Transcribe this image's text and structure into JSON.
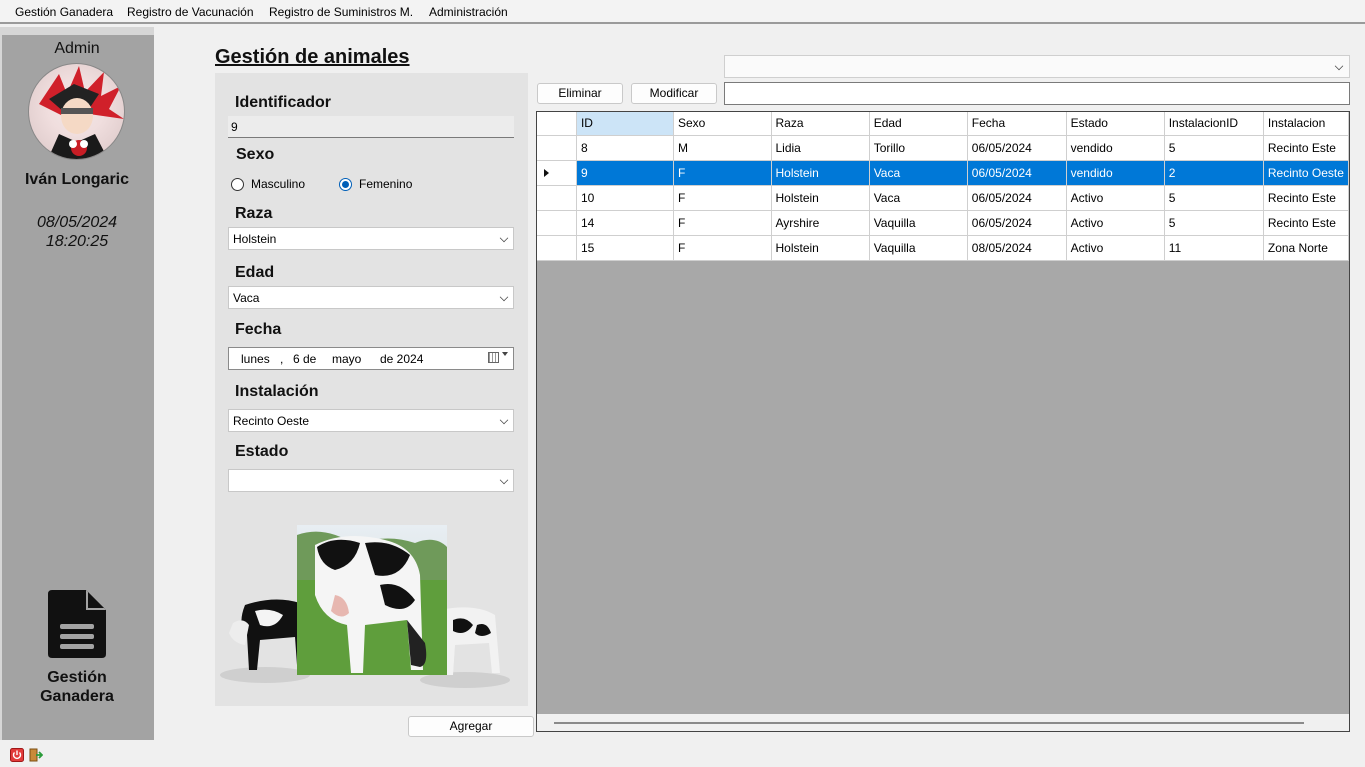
{
  "menu": [
    "Gestión Ganadera",
    "Registro de Vacunación",
    "Registro de Suministros M.",
    "Administración"
  ],
  "sidebar": {
    "role": "Admin",
    "user": "Iván Longaric",
    "date": "08/05/2024",
    "time": "18:20:25",
    "module_label_1": "Gestión",
    "module_label_2": "Ganadera"
  },
  "title": "Gestión de animales",
  "form": {
    "id_label": "Identificador",
    "id_value": "9",
    "sex_label": "Sexo",
    "sex_options": [
      "Masculino",
      "Femenino"
    ],
    "sex_selected": "Femenino",
    "breed_label": "Raza",
    "breed_value": "Holstein",
    "age_label": "Edad",
    "age_value": "Vaca",
    "date_label": "Fecha",
    "date_parts": {
      "weekday": "lunes",
      "sep": ",",
      "day": "6 de",
      "month": "mayo",
      "year": "de 2024"
    },
    "install_label": "Instalación",
    "install_value": "Recinto Oeste",
    "state_label": "Estado",
    "state_value": ""
  },
  "buttons": {
    "delete": "Eliminar",
    "modify": "Modificar",
    "add": "Agregar"
  },
  "table": {
    "columns": [
      "ID",
      "Sexo",
      "Raza",
      "Edad",
      "Fecha",
      "Estado",
      "InstalacionID",
      "Instalacion"
    ],
    "rows": [
      [
        "8",
        "M",
        "Lidia",
        "Torillo",
        "06/05/2024",
        "vendido",
        "5",
        "Recinto Este"
      ],
      [
        "9",
        "F",
        "Holstein",
        "Vaca",
        "06/05/2024",
        "vendido",
        "2",
        "Recinto Oeste"
      ],
      [
        "10",
        "F",
        "Holstein",
        "Vaca",
        "06/05/2024",
        "Activo",
        "5",
        "Recinto Este"
      ],
      [
        "14",
        "F",
        "Ayrshire",
        "Vaquilla",
        "06/05/2024",
        "Activo",
        "5",
        "Recinto Este"
      ],
      [
        "15",
        "F",
        "Holstein",
        "Vaquilla",
        "08/05/2024",
        "Activo",
        "11",
        "Zona Norte"
      ]
    ],
    "selected_row": 1
  },
  "colors": {
    "selection": "#0078d7",
    "sidebar": "#a3a3a3",
    "grid_bg": "#a8a8a8"
  },
  "icons": [
    "document-icon",
    "power-icon",
    "logout-icon",
    "calendar-icon"
  ]
}
